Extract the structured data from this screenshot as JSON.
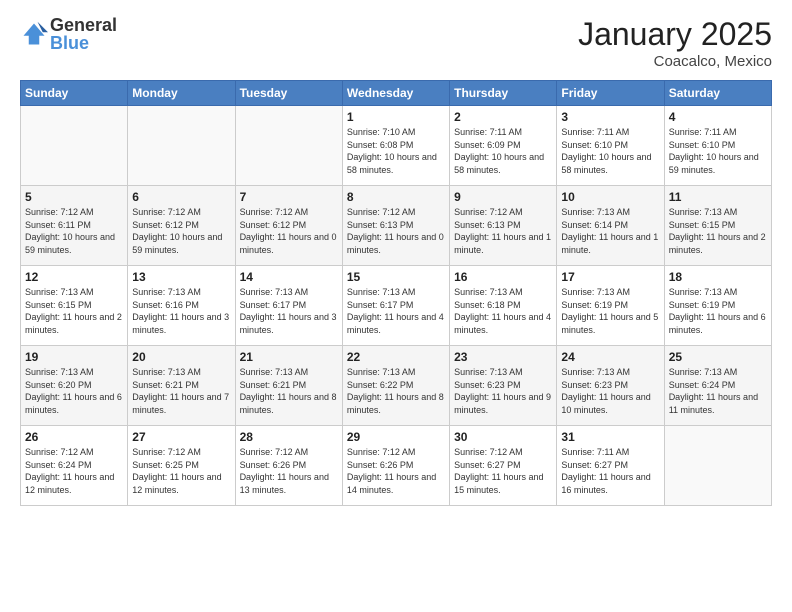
{
  "logo": {
    "general": "General",
    "blue": "Blue"
  },
  "header": {
    "title": "January 2025",
    "location": "Coacalco, Mexico"
  },
  "weekdays": [
    "Sunday",
    "Monday",
    "Tuesday",
    "Wednesday",
    "Thursday",
    "Friday",
    "Saturday"
  ],
  "weeks": [
    [
      {
        "day": "",
        "sunrise": "",
        "sunset": "",
        "daylight": ""
      },
      {
        "day": "",
        "sunrise": "",
        "sunset": "",
        "daylight": ""
      },
      {
        "day": "",
        "sunrise": "",
        "sunset": "",
        "daylight": ""
      },
      {
        "day": "1",
        "sunrise": "Sunrise: 7:10 AM",
        "sunset": "Sunset: 6:08 PM",
        "daylight": "Daylight: 10 hours and 58 minutes."
      },
      {
        "day": "2",
        "sunrise": "Sunrise: 7:11 AM",
        "sunset": "Sunset: 6:09 PM",
        "daylight": "Daylight: 10 hours and 58 minutes."
      },
      {
        "day": "3",
        "sunrise": "Sunrise: 7:11 AM",
        "sunset": "Sunset: 6:10 PM",
        "daylight": "Daylight: 10 hours and 58 minutes."
      },
      {
        "day": "4",
        "sunrise": "Sunrise: 7:11 AM",
        "sunset": "Sunset: 6:10 PM",
        "daylight": "Daylight: 10 hours and 59 minutes."
      }
    ],
    [
      {
        "day": "5",
        "sunrise": "Sunrise: 7:12 AM",
        "sunset": "Sunset: 6:11 PM",
        "daylight": "Daylight: 10 hours and 59 minutes."
      },
      {
        "day": "6",
        "sunrise": "Sunrise: 7:12 AM",
        "sunset": "Sunset: 6:12 PM",
        "daylight": "Daylight: 10 hours and 59 minutes."
      },
      {
        "day": "7",
        "sunrise": "Sunrise: 7:12 AM",
        "sunset": "Sunset: 6:12 PM",
        "daylight": "Daylight: 11 hours and 0 minutes."
      },
      {
        "day": "8",
        "sunrise": "Sunrise: 7:12 AM",
        "sunset": "Sunset: 6:13 PM",
        "daylight": "Daylight: 11 hours and 0 minutes."
      },
      {
        "day": "9",
        "sunrise": "Sunrise: 7:12 AM",
        "sunset": "Sunset: 6:13 PM",
        "daylight": "Daylight: 11 hours and 1 minute."
      },
      {
        "day": "10",
        "sunrise": "Sunrise: 7:13 AM",
        "sunset": "Sunset: 6:14 PM",
        "daylight": "Daylight: 11 hours and 1 minute."
      },
      {
        "day": "11",
        "sunrise": "Sunrise: 7:13 AM",
        "sunset": "Sunset: 6:15 PM",
        "daylight": "Daylight: 11 hours and 2 minutes."
      }
    ],
    [
      {
        "day": "12",
        "sunrise": "Sunrise: 7:13 AM",
        "sunset": "Sunset: 6:15 PM",
        "daylight": "Daylight: 11 hours and 2 minutes."
      },
      {
        "day": "13",
        "sunrise": "Sunrise: 7:13 AM",
        "sunset": "Sunset: 6:16 PM",
        "daylight": "Daylight: 11 hours and 3 minutes."
      },
      {
        "day": "14",
        "sunrise": "Sunrise: 7:13 AM",
        "sunset": "Sunset: 6:17 PM",
        "daylight": "Daylight: 11 hours and 3 minutes."
      },
      {
        "day": "15",
        "sunrise": "Sunrise: 7:13 AM",
        "sunset": "Sunset: 6:17 PM",
        "daylight": "Daylight: 11 hours and 4 minutes."
      },
      {
        "day": "16",
        "sunrise": "Sunrise: 7:13 AM",
        "sunset": "Sunset: 6:18 PM",
        "daylight": "Daylight: 11 hours and 4 minutes."
      },
      {
        "day": "17",
        "sunrise": "Sunrise: 7:13 AM",
        "sunset": "Sunset: 6:19 PM",
        "daylight": "Daylight: 11 hours and 5 minutes."
      },
      {
        "day": "18",
        "sunrise": "Sunrise: 7:13 AM",
        "sunset": "Sunset: 6:19 PM",
        "daylight": "Daylight: 11 hours and 6 minutes."
      }
    ],
    [
      {
        "day": "19",
        "sunrise": "Sunrise: 7:13 AM",
        "sunset": "Sunset: 6:20 PM",
        "daylight": "Daylight: 11 hours and 6 minutes."
      },
      {
        "day": "20",
        "sunrise": "Sunrise: 7:13 AM",
        "sunset": "Sunset: 6:21 PM",
        "daylight": "Daylight: 11 hours and 7 minutes."
      },
      {
        "day": "21",
        "sunrise": "Sunrise: 7:13 AM",
        "sunset": "Sunset: 6:21 PM",
        "daylight": "Daylight: 11 hours and 8 minutes."
      },
      {
        "day": "22",
        "sunrise": "Sunrise: 7:13 AM",
        "sunset": "Sunset: 6:22 PM",
        "daylight": "Daylight: 11 hours and 8 minutes."
      },
      {
        "day": "23",
        "sunrise": "Sunrise: 7:13 AM",
        "sunset": "Sunset: 6:23 PM",
        "daylight": "Daylight: 11 hours and 9 minutes."
      },
      {
        "day": "24",
        "sunrise": "Sunrise: 7:13 AM",
        "sunset": "Sunset: 6:23 PM",
        "daylight": "Daylight: 11 hours and 10 minutes."
      },
      {
        "day": "25",
        "sunrise": "Sunrise: 7:13 AM",
        "sunset": "Sunset: 6:24 PM",
        "daylight": "Daylight: 11 hours and 11 minutes."
      }
    ],
    [
      {
        "day": "26",
        "sunrise": "Sunrise: 7:12 AM",
        "sunset": "Sunset: 6:24 PM",
        "daylight": "Daylight: 11 hours and 12 minutes."
      },
      {
        "day": "27",
        "sunrise": "Sunrise: 7:12 AM",
        "sunset": "Sunset: 6:25 PM",
        "daylight": "Daylight: 11 hours and 12 minutes."
      },
      {
        "day": "28",
        "sunrise": "Sunrise: 7:12 AM",
        "sunset": "Sunset: 6:26 PM",
        "daylight": "Daylight: 11 hours and 13 minutes."
      },
      {
        "day": "29",
        "sunrise": "Sunrise: 7:12 AM",
        "sunset": "Sunset: 6:26 PM",
        "daylight": "Daylight: 11 hours and 14 minutes."
      },
      {
        "day": "30",
        "sunrise": "Sunrise: 7:12 AM",
        "sunset": "Sunset: 6:27 PM",
        "daylight": "Daylight: 11 hours and 15 minutes."
      },
      {
        "day": "31",
        "sunrise": "Sunrise: 7:11 AM",
        "sunset": "Sunset: 6:27 PM",
        "daylight": "Daylight: 11 hours and 16 minutes."
      },
      {
        "day": "",
        "sunrise": "",
        "sunset": "",
        "daylight": ""
      }
    ]
  ]
}
